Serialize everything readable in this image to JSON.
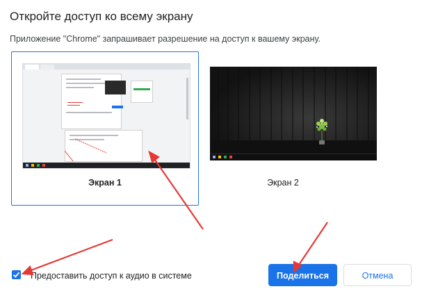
{
  "dialog": {
    "title": "Откройте доступ ко всему экрану",
    "subtitle": "Приложение \"Chrome\" запрашивает разрешение на доступ к вашему экрану."
  },
  "screens": [
    {
      "label": "Экран 1",
      "selected": true
    },
    {
      "label": "Экран 2",
      "selected": false
    }
  ],
  "audio": {
    "label": "Предоставить доступ к аудио в системе",
    "checked": true
  },
  "buttons": {
    "share_label": "Поделиться",
    "cancel_label": "Отмена"
  },
  "colors": {
    "accent": "#1a73e8",
    "annotation": "#e53935"
  },
  "icons": {
    "checkbox": "check-icon"
  }
}
